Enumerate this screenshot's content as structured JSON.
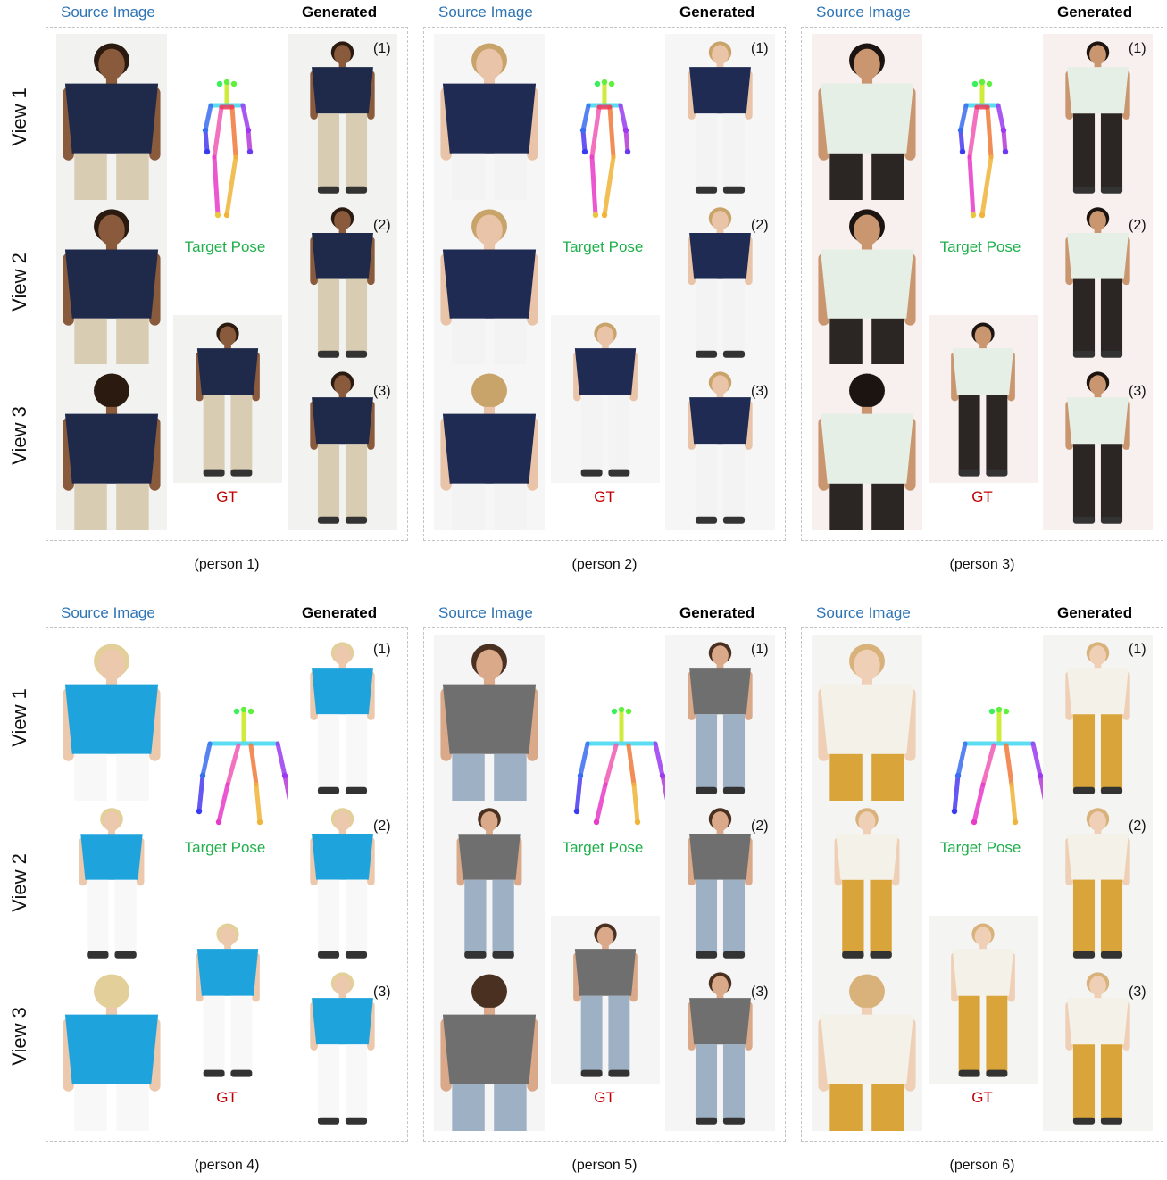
{
  "labels": {
    "source_image": "Source Image",
    "generated": "Generated",
    "target_pose": "Target Pose",
    "gt": "GT",
    "view_1": "View 1",
    "view_2": "View 2",
    "view_3": "View 3",
    "num_1": "(1)",
    "num_2": "(2)",
    "num_3": "(3)"
  },
  "captions": [
    "(person 1)",
    "(person 2)",
    "(person 3)",
    "(person 4)",
    "(person 5)",
    "(person 6)"
  ],
  "people": [
    {
      "shirt": "#1f2a4a",
      "pants": "#d8ccb3",
      "skin": "#8a5a3c",
      "hair": "#2a1a10",
      "bg": "#f2f2f0"
    },
    {
      "shirt": "#1f2b52",
      "pants": "#f3f3f3",
      "skin": "#e9c4a8",
      "hair": "#c9a46a",
      "bg": "#f6f6f6"
    },
    {
      "shirt": "#e6efe6",
      "pants": "#2b2523",
      "skin": "#c9966f",
      "hair": "#1c1410",
      "bg": "#f7f0ee"
    },
    {
      "shirt": "#1fa3dc",
      "pants": "#f8f8f8",
      "skin": "#ecc8ad",
      "hair": "#e3cf9a",
      "bg": "#ffffff"
    },
    {
      "shirt": "#6f6f6f",
      "pants": "#9eb0c4",
      "skin": "#d9a98a",
      "hair": "#4a3020",
      "bg": "#f5f5f5"
    },
    {
      "shirt": "#f4f1e8",
      "pants": "#d9a53a",
      "skin": "#efcfb5",
      "hair": "#d8b27a",
      "bg": "#f4f4f2"
    }
  ]
}
